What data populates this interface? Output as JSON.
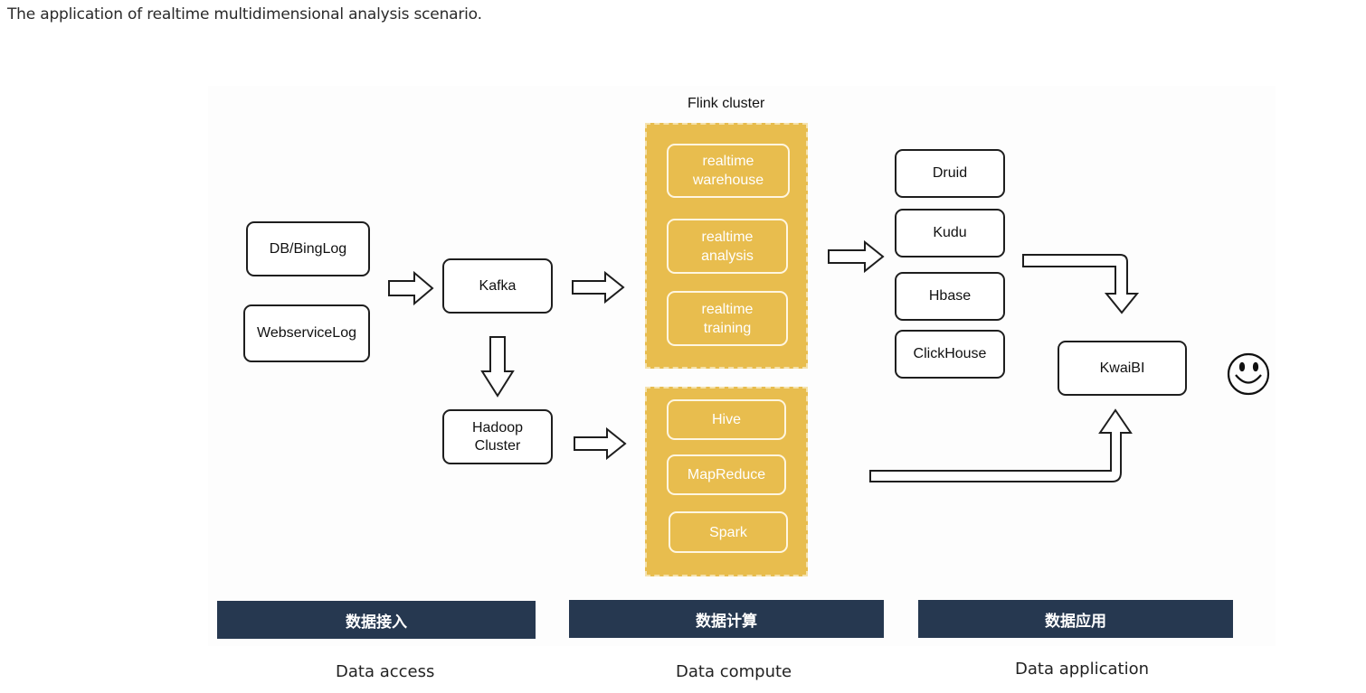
{
  "caption": "The application of realtime multidimensional analysis scenario.",
  "diagram": {
    "sources": [
      "DB/BingLog",
      "WebserviceLog"
    ],
    "ingest": {
      "kafka": "Kafka",
      "hadoop": "Hadoop\nCluster"
    },
    "flink_cluster": {
      "title": "Flink cluster",
      "items": [
        "realtime\nwarehouse",
        "realtime\nanalysis",
        "realtime\ntraining"
      ]
    },
    "batch_cluster": {
      "items": [
        "Hive",
        "MapReduce",
        "Spark"
      ]
    },
    "storage": [
      "Druid",
      "Kudu",
      "Hbase",
      "ClickHouse"
    ],
    "bi": "KwaiBI",
    "smiley_icon": "smiley-face-icon",
    "colors": {
      "cluster": "#e8bd4e",
      "band": "#263850",
      "stroke": "#1e1e1e"
    }
  },
  "sections": [
    {
      "band": "数据接入",
      "label": "Data access"
    },
    {
      "band": "数据计算",
      "label": "Data compute"
    },
    {
      "band": "数据应用",
      "label": "Data application"
    }
  ]
}
